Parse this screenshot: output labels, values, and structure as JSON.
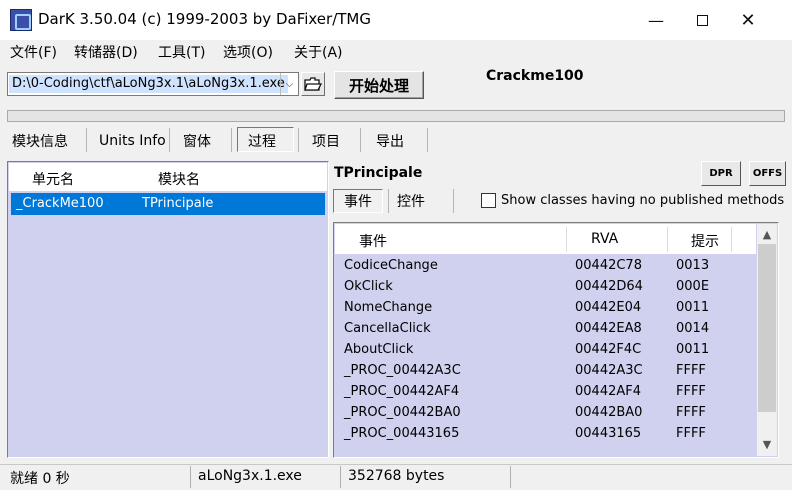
{
  "window": {
    "title": "DarK 3.50.04 (c) 1999-2003 by DaFixer/TMG"
  },
  "menu": [
    "文件(F)",
    "转储器(D)",
    "工具(T)",
    "选项(O)",
    "关于(A)"
  ],
  "toolbar": {
    "path_value": "D:\\0-Coding\\ctf\\aLoNg3x.1\\aLoNg3x.1.exe",
    "start_label": "开始处理",
    "crackme_label": "Crackme100",
    "progress": 0
  },
  "main_tabs": [
    "模块信息",
    "Units Info",
    "窗体",
    "过程",
    "项目",
    "导出"
  ],
  "left_table": {
    "headers": [
      "单元名",
      "模块名"
    ],
    "rows": [
      {
        "unit": "_CrackMe100",
        "module": "TPrincipale"
      }
    ]
  },
  "right": {
    "class_name": "TPrincipale",
    "dpr_label": "DPR",
    "offs_label": "OFFS",
    "sub_tabs": [
      "事件",
      "控件"
    ],
    "checkbox_label": "Show classes having no published methods",
    "checkbox_checked": false,
    "headers": [
      "事件",
      "RVA",
      "提示"
    ],
    "rows": [
      {
        "name": "CodiceChange",
        "rva": "00442C78",
        "hint": "0013"
      },
      {
        "name": "OkClick",
        "rva": "00442D64",
        "hint": "000E"
      },
      {
        "name": "NomeChange",
        "rva": "00442E04",
        "hint": "0011"
      },
      {
        "name": "CancellaClick",
        "rva": "00442EA8",
        "hint": "0014"
      },
      {
        "name": "AboutClick",
        "rva": "00442F4C",
        "hint": "0011"
      },
      {
        "name": "_PROC_00442A3C",
        "rva": "00442A3C",
        "hint": "FFFF"
      },
      {
        "name": "_PROC_00442AF4",
        "rva": "00442AF4",
        "hint": "FFFF"
      },
      {
        "name": "_PROC_00442BA0",
        "rva": "00442BA0",
        "hint": "FFFF"
      },
      {
        "name": "_PROC_00443165",
        "rva": "00443165",
        "hint": "FFFF"
      }
    ]
  },
  "status": {
    "ready": "就绪 0 秒",
    "file": "aLoNg3x.1.exe",
    "size": "352768 bytes"
  },
  "icons": {
    "app": "dark-app-icon",
    "minimize": "minimize-icon",
    "maximize": "maximize-icon",
    "close": "close-icon",
    "dropdown": "chevron-down-icon",
    "open": "open-folder-icon",
    "scroll_up": "chevron-up-icon",
    "scroll_down": "chevron-down-icon"
  },
  "colors": {
    "list_bg": "#cfd1ee",
    "selection": "#0078d7"
  }
}
